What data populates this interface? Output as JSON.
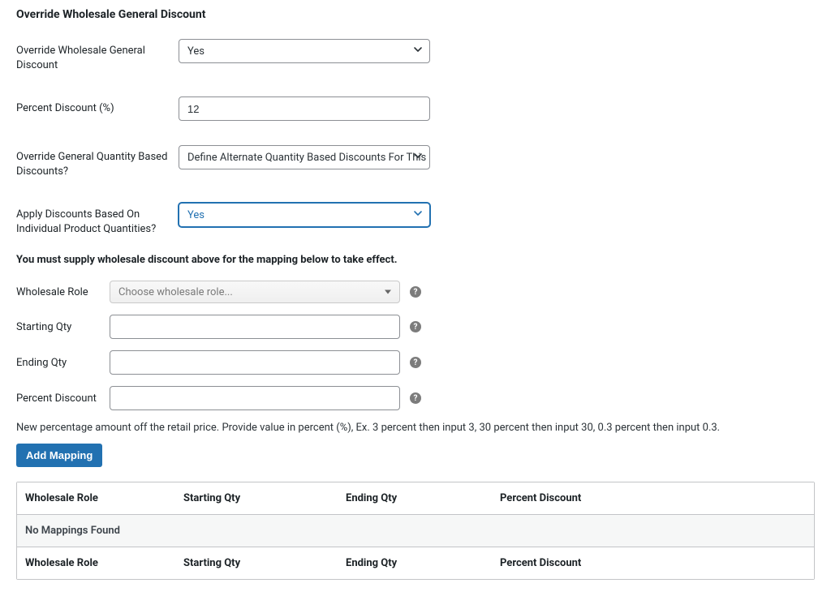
{
  "section": {
    "title": "Override Wholesale General Discount"
  },
  "fields": {
    "override_general": {
      "label": "Override Wholesale General Discount",
      "value": "Yes"
    },
    "percent_discount": {
      "label": "Percent Discount (%)",
      "value": "12"
    },
    "override_qty": {
      "label": "Override General Quantity Based Discounts?",
      "value": "Define Alternate Quantity Based Discounts For This Category"
    },
    "apply_individual": {
      "label": "Apply Discounts Based On Individual Product Quantities?",
      "value": "Yes"
    }
  },
  "notice": "You must supply wholesale discount above for the mapping below to take effect.",
  "mapping_form": {
    "role": {
      "label": "Wholesale Role",
      "placeholder": "Choose wholesale role..."
    },
    "start": {
      "label": "Starting Qty",
      "value": ""
    },
    "end": {
      "label": "Ending Qty",
      "value": ""
    },
    "percent": {
      "label": "Percent Discount",
      "value": ""
    },
    "hint": "New percentage amount off the retail price. Provide value in percent (%), Ex. 3 percent then input 3, 30 percent then input 30, 0.3 percent then input 0.3.",
    "button": "Add Mapping",
    "help_glyph": "?"
  },
  "table": {
    "columns": {
      "role": "Wholesale Role",
      "start": "Starting Qty",
      "end": "Ending Qty",
      "percent": "Percent Discount"
    },
    "empty": "No Mappings Found"
  }
}
